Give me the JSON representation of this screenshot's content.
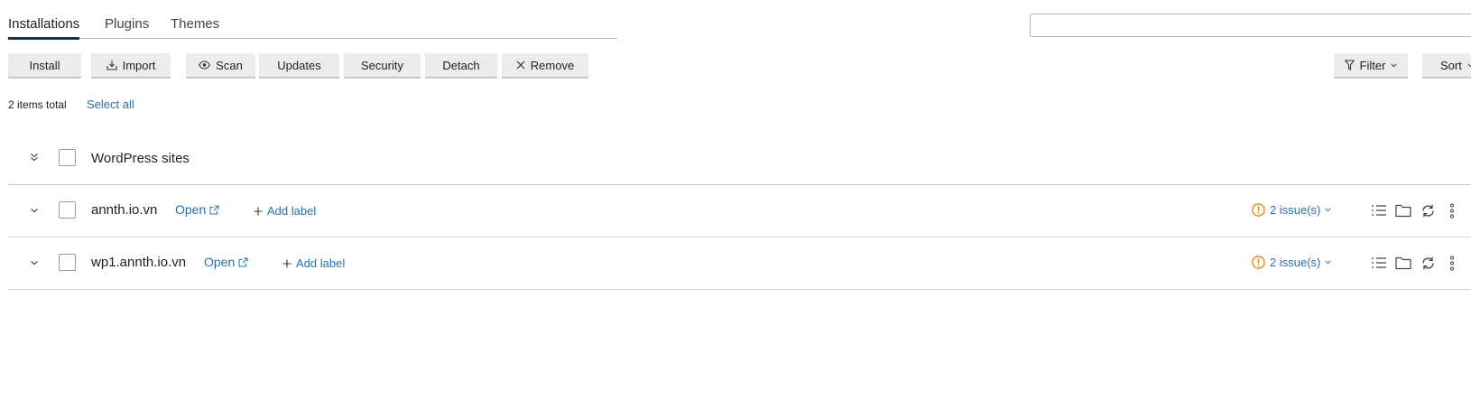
{
  "tabs": [
    {
      "label": "Installations",
      "active": true
    },
    {
      "label": "Plugins",
      "active": false
    },
    {
      "label": "Themes",
      "active": false
    }
  ],
  "search": {
    "value": "",
    "placeholder": ""
  },
  "toolbar": {
    "install": "Install",
    "import": "Import",
    "scan": "Scan",
    "updates": "Updates",
    "security": "Security",
    "detach": "Detach",
    "remove": "Remove",
    "filter": "Filter",
    "sort": "Sort"
  },
  "summary": {
    "total": "2 items total",
    "select_all": "Select all"
  },
  "group": {
    "name": "WordPress sites"
  },
  "sites": [
    {
      "name": "annth.io.vn",
      "open": "Open",
      "add_label": "Add label",
      "issues": "2 issue(s)"
    },
    {
      "name": "wp1.annth.io.vn",
      "open": "Open",
      "add_label": "Add label",
      "issues": "2 issue(s)"
    }
  ],
  "colors": {
    "link": "#2872a8",
    "warning": "#e07b00",
    "tab_underline": "#1f2f4a"
  },
  "icons": [
    "import-icon",
    "eye-icon",
    "close-icon",
    "filter-icon",
    "chevron-down-icon",
    "double-chevron-down-icon",
    "external-link-icon",
    "plus-icon",
    "warning-circle-icon",
    "list-icon",
    "folder-icon",
    "refresh-icon",
    "more-vertical-icon",
    "search-icon"
  ]
}
